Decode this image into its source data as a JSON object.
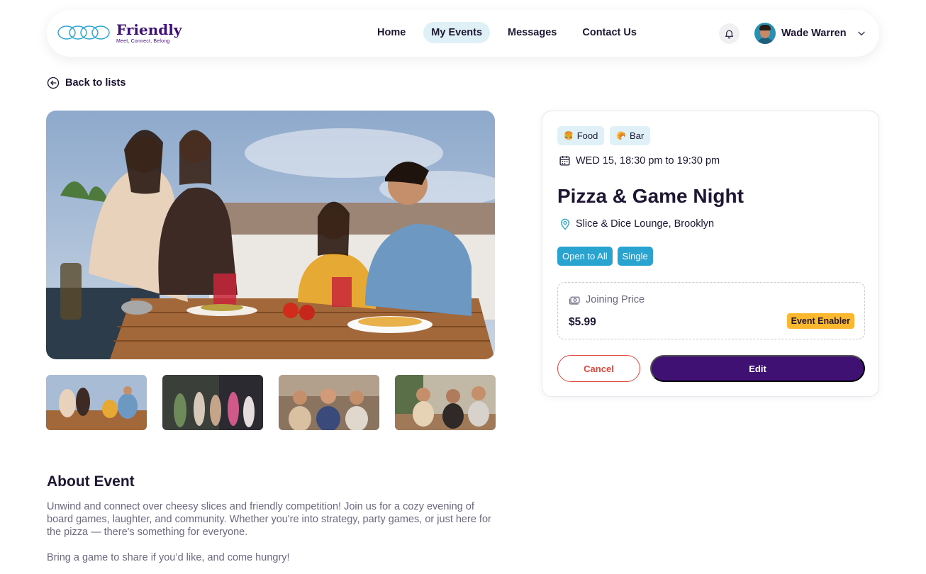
{
  "brand": {
    "name": "Friendly",
    "tagline": "Meet, Connect, Belong"
  },
  "nav": {
    "items": [
      {
        "label": "Home",
        "active": false
      },
      {
        "label": "My Events",
        "active": true
      },
      {
        "label": "Messages",
        "active": false
      },
      {
        "label": "Contact Us",
        "active": false
      }
    ]
  },
  "user": {
    "name": "Wade Warren"
  },
  "back_label": "Back to lists",
  "event": {
    "categories": [
      {
        "emoji": "🍔",
        "label": "Food"
      },
      {
        "emoji": "🥐",
        "label": "Bar"
      }
    ],
    "datetime": "WED 15, 18:30 pm to 19:30 pm",
    "title": "Pizza & Game Night",
    "location": "Slice & Dice Lounge, Brooklyn",
    "tags": [
      "Open to All",
      "Single"
    ],
    "price_label": "Joining Price",
    "price": "$5.99",
    "badge": "Event Enabler",
    "cancel_label": "Cancel",
    "edit_label": "Edit"
  },
  "about": {
    "title": "About Event",
    "paragraph1": "Unwind and connect over cheesy slices and friendly competition! Join us for a cozy evening of board games, laughter, and community. Whether you're into strategy, party games, or just here for the pizza — there's something for everyone.",
    "paragraph2": "Bring a game to share if you’d like, and come hungry!"
  },
  "colors": {
    "brand_purple": "#3f1173",
    "accent_blue": "#29a3cf",
    "light_blue": "#dff0f7",
    "badge_yellow": "#fbb82f",
    "cancel_red": "#e0473b"
  },
  "icons": [
    "logo-mark",
    "bell-icon",
    "chevron-down-icon",
    "back-arrow-icon",
    "calendar-icon",
    "location-pin-icon",
    "money-icon"
  ]
}
